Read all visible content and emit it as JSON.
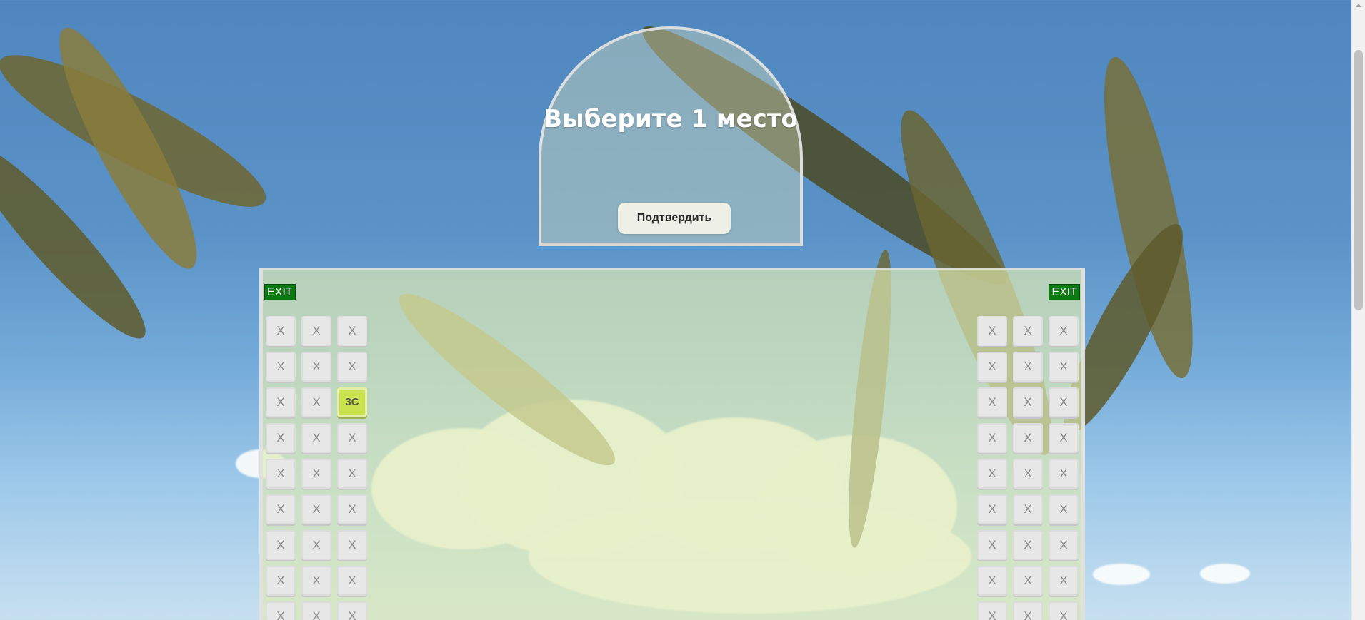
{
  "header": {
    "title": "Выберите 1 место",
    "confirm_label": "Подтвердить"
  },
  "cabin": {
    "exit_left_label": "EXIT",
    "exit_right_label": "EXIT",
    "left_block": [
      [
        "X",
        "X",
        "X"
      ],
      [
        "X",
        "X",
        "X"
      ],
      [
        "X",
        "X",
        "3C"
      ],
      [
        "X",
        "X",
        "X"
      ],
      [
        "X",
        "X",
        "X"
      ],
      [
        "X",
        "X",
        "X"
      ],
      [
        "X",
        "X",
        "X"
      ],
      [
        "X",
        "X",
        "X"
      ],
      [
        "X",
        "X",
        "X"
      ]
    ],
    "right_block": [
      [
        "X",
        "X",
        "X"
      ],
      [
        "X",
        "X",
        "X"
      ],
      [
        "X",
        "X",
        "X"
      ],
      [
        "X",
        "X",
        "X"
      ],
      [
        "X",
        "X",
        "X"
      ],
      [
        "X",
        "X",
        "X"
      ],
      [
        "X",
        "X",
        "X"
      ],
      [
        "X",
        "X",
        "X"
      ],
      [
        "X",
        "X",
        "X"
      ]
    ],
    "taken_seat_mark": "X",
    "free_seat_color": "#c9e24e",
    "taken_seat_color": "#e7e7e7",
    "exit_color": "#0c7a12"
  },
  "colors": {
    "cabin_overlay": "#dfeab2",
    "dome_border": "#e1e1e1"
  }
}
